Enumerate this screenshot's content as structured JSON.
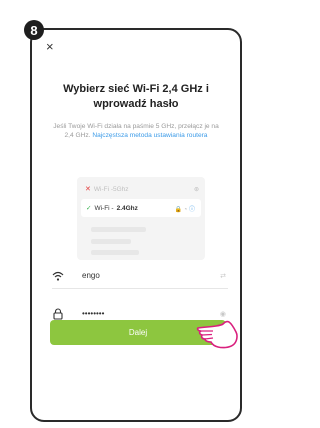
{
  "step": "8",
  "close_label": "×",
  "title": "Wybierz sieć Wi-Fi 2,4 GHz i wprowadź hasło",
  "description": "Jeśli Twoje Wi-Fi działa na paśmie 5 GHz, przełącz je na 2,4 GHz.",
  "description_link": "Najczęstsza metoda ustawiania routera",
  "wifi_examples": [
    {
      "prefix": "Wi-Fi - ",
      "name": "5Ghz",
      "status": "x"
    },
    {
      "prefix": "Wi-Fi - ",
      "name": "2.4Ghz",
      "status": "check"
    }
  ],
  "wifi_field": {
    "value": "engo"
  },
  "password_field": {
    "value": "••••••••"
  },
  "next_button": "Dalej",
  "colors": {
    "accent": "#8dc63f",
    "link": "#3c9be8",
    "error": "#e23b3b",
    "ok": "#37b24d"
  }
}
